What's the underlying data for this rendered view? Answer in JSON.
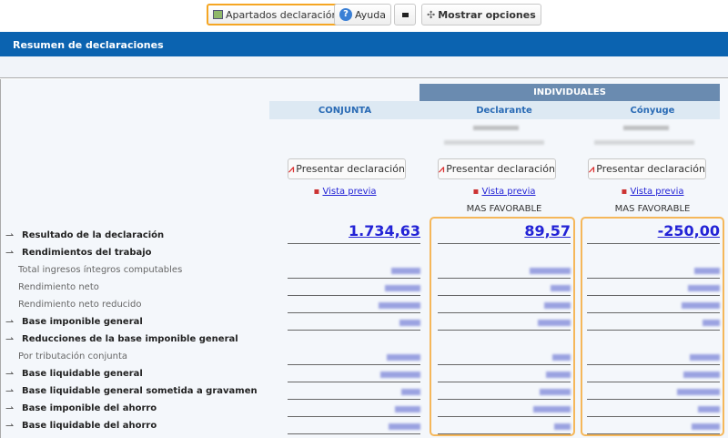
{
  "toolbar": {
    "apartados": "Apartados declaración",
    "ayuda": "Ayuda",
    "mostrar": "Mostrar opciones"
  },
  "header": {
    "title": "Resumen de declaraciones"
  },
  "table": {
    "group_header": "INDIVIDUALES",
    "columns": [
      {
        "label": "CONJUNTA",
        "present": "Presentar declaración",
        "preview": "Vista previa",
        "badge": "",
        "result": "1.734,63"
      },
      {
        "label": "Declarante",
        "present": "Presentar declaración",
        "preview": "Vista previa",
        "badge": "MAS FAVORABLE",
        "result": "89,57"
      },
      {
        "label": "Cónyuge",
        "present": "Presentar declaración",
        "preview": "Vista previa",
        "badge": "MAS FAVORABLE",
        "result": "-250,00"
      }
    ],
    "highlight_color": "#f5b75a",
    "rows": [
      {
        "label": "Resultado de la declaración",
        "bold": true
      },
      {
        "label": "Rendimientos del trabajo",
        "bold": true,
        "header": true
      },
      {
        "label": "Total ingresos íntegros computables",
        "bold": false
      },
      {
        "label": "Rendimiento neto",
        "bold": false
      },
      {
        "label": "Rendimiento neto reducido",
        "bold": false
      },
      {
        "label": "Base imponible general",
        "bold": true
      },
      {
        "label": "Reducciones de la base imponible general",
        "bold": true,
        "header": true
      },
      {
        "label": "Por tributación conjunta",
        "bold": false
      },
      {
        "label": "Base liquidable general",
        "bold": true
      },
      {
        "label": "Base liquidable general sometida a gravamen",
        "bold": true
      },
      {
        "label": "Base imponible del ahorro",
        "bold": true
      },
      {
        "label": "Base liquidable del ahorro",
        "bold": true
      }
    ]
  }
}
